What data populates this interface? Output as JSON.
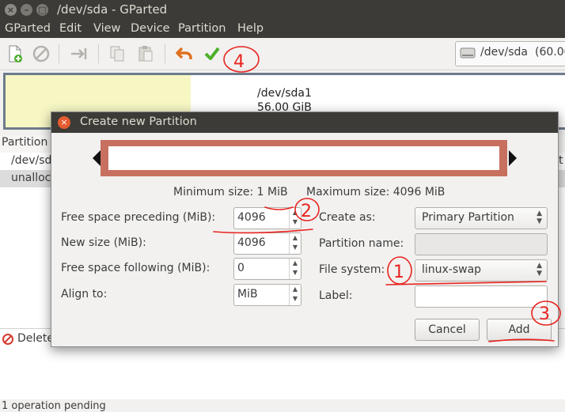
{
  "window": {
    "title": "/dev/sda - GParted"
  },
  "menu": [
    "GParted",
    "Edit",
    "View",
    "Device",
    "Partition",
    "Help"
  ],
  "device_selector": {
    "label": "/dev/sda",
    "size": "(60.00"
  },
  "graph": {
    "partition": "/dev/sda1",
    "size": "56.00 GiB"
  },
  "list": {
    "header": "Partition",
    "rows": [
      "/dev/sd",
      "unalloc"
    ],
    "right_text": "t"
  },
  "operations": {
    "item": "Delete"
  },
  "status": {
    "text": "1 operation pending"
  },
  "dialog": {
    "title": "Create new Partition",
    "min_size": "Minimum size: 1 MiB",
    "max_size": "Maximum size: 4096 MiB",
    "free_preceding_label": "Free space preceding (MiB):",
    "free_preceding_value": "4096",
    "new_size_label": "New size (MiB):",
    "new_size_value": "4096",
    "free_following_label": "Free space following (MiB):",
    "free_following_value": "0",
    "align_label": "Align to:",
    "align_value": "MiB",
    "create_as_label": "Create as:",
    "create_as_value": "Primary Partition",
    "partition_name_label": "Partition name:",
    "file_system_label": "File system:",
    "file_system_value": "linux-swap",
    "label_label": "Label:",
    "cancel": "Cancel",
    "add": "Add"
  },
  "annotations": [
    "1",
    "2",
    "3",
    "4"
  ],
  "colors": {
    "annotation": "#e8231f",
    "resize_bar": "#c8705f",
    "titlebar": "#3c3b37"
  }
}
